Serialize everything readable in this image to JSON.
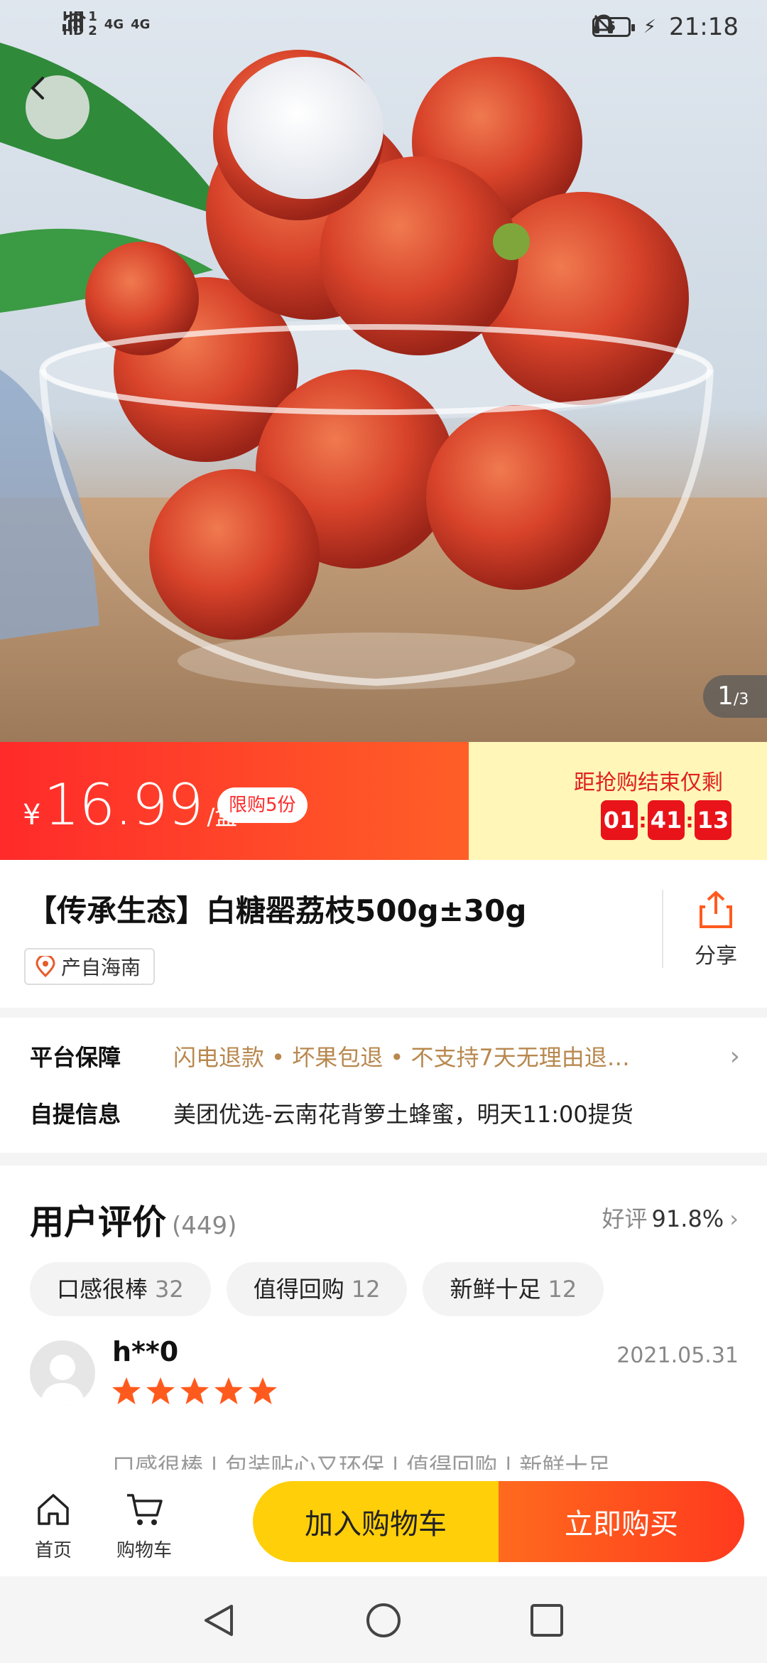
{
  "status_bar": {
    "sim_labels": [
      "HD 1",
      "HD 2"
    ],
    "network": "4G",
    "battery": "5",
    "time": "21:18"
  },
  "gallery": {
    "current": "1",
    "total": "/3"
  },
  "price_bar": {
    "currency": "¥",
    "price": "16.99",
    "unit": "/盒",
    "limit": "限购5份",
    "countdown_label": "距抢购结束仅剩",
    "countdown": {
      "h": "01",
      "m": "41",
      "s": "13"
    },
    "colors": {
      "red": "#ff2a2a",
      "yellow": "#fff6b8"
    }
  },
  "product": {
    "title": "【传承生态】白糖罂荔枝500g±30g",
    "origin": "产自海南",
    "share_label": "分享"
  },
  "info": {
    "guarantee_label": "平台保障",
    "guarantee_value": "闪电退款 • 坏果包退 • 不支持7天无理由退…",
    "pickup_label": "自提信息",
    "pickup_value": "美团优选-云南花背箩土蜂蜜，明天11:00提货"
  },
  "reviews": {
    "title": "用户评价",
    "count": "(449)",
    "good_rate_label": "好评",
    "good_rate": "91.8%",
    "tags": [
      {
        "label": "口感很棒",
        "count": "32"
      },
      {
        "label": "值得回购",
        "count": "12"
      },
      {
        "label": "新鲜十足",
        "count": "12"
      }
    ],
    "first": {
      "user": "h**0",
      "date": "2021.05.31",
      "rating": 5,
      "tags_line": "口感很棒  |  包装贴心又环保  |  值得回购  |  新鲜十足"
    }
  },
  "bottom_bar": {
    "home_label": "首页",
    "cart_label": "购物车",
    "add_to_cart": "加入购物车",
    "buy_now": "立即购买"
  }
}
